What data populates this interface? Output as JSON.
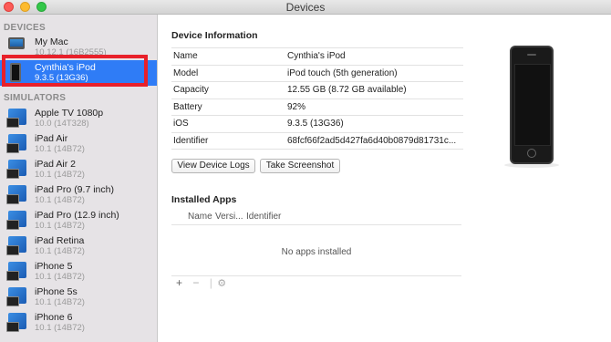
{
  "window": {
    "title": "Devices"
  },
  "sidebar": {
    "devices_header": "DEVICES",
    "simulators_header": "SIMULATORS",
    "devices": [
      {
        "name": "My Mac",
        "sub": "10.12.1 (16B2555)",
        "icon": "mac-icon"
      },
      {
        "name": "Cynthia's iPod",
        "sub": "9.3.5 (13G36)",
        "icon": "ipod-icon",
        "selected": true
      }
    ],
    "simulators": [
      {
        "name": "Apple TV 1080p",
        "sub": "10.0 (14T328)"
      },
      {
        "name": "iPad Air",
        "sub": "10.1 (14B72)"
      },
      {
        "name": "iPad Air 2",
        "sub": "10.1 (14B72)"
      },
      {
        "name": "iPad Pro (9.7 inch)",
        "sub": "10.1 (14B72)"
      },
      {
        "name": "iPad Pro (12.9 inch)",
        "sub": "10.1 (14B72)"
      },
      {
        "name": "iPad Retina",
        "sub": "10.1 (14B72)"
      },
      {
        "name": "iPhone 5",
        "sub": "10.1 (14B72)"
      },
      {
        "name": "iPhone 5s",
        "sub": "10.1 (14B72)"
      },
      {
        "name": "iPhone 6",
        "sub": "10.1 (14B72)"
      }
    ]
  },
  "main": {
    "device_info_title": "Device Information",
    "info": [
      {
        "key": "Name",
        "value": "Cynthia's iPod"
      },
      {
        "key": "Model",
        "value": "iPod touch (5th generation)"
      },
      {
        "key": "Capacity",
        "value": "12.55 GB (8.72 GB available)"
      },
      {
        "key": "Battery",
        "value": "92%"
      },
      {
        "key": "iOS",
        "value": "9.3.5 (13G36)"
      },
      {
        "key": "Identifier",
        "value": "68fcf66f2ad5d427fa6d40b0879d81731c..."
      }
    ],
    "view_logs_label": "View Device Logs",
    "screenshot_label": "Take Screenshot",
    "installed_apps_title": "Installed Apps",
    "apps_columns": [
      "Name",
      "Versi...",
      "Identifier"
    ],
    "no_apps_text": "No apps installed",
    "tools": {
      "add": "+",
      "remove": "−",
      "separator": "|",
      "settings": "⚙"
    }
  },
  "colors": {
    "selection": "#2f7cf6",
    "highlight_box": "#e8202a"
  }
}
